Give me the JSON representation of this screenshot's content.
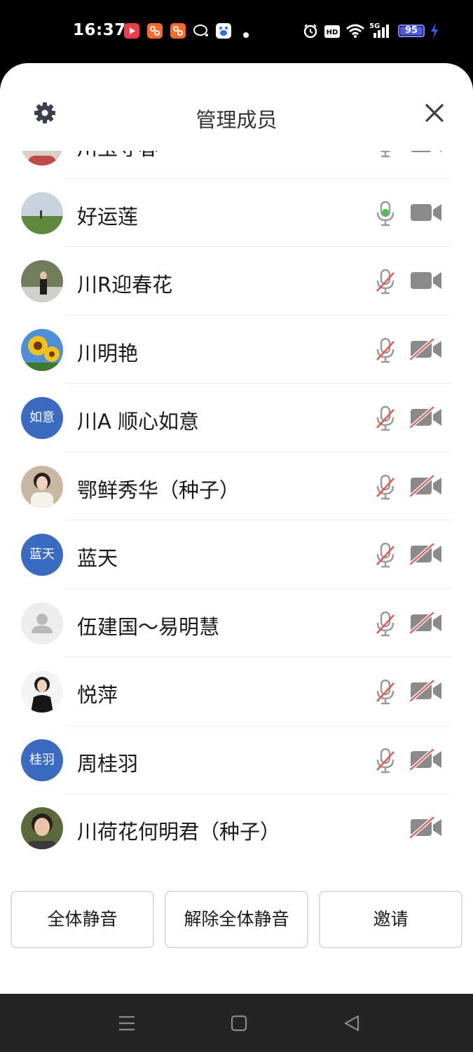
{
  "status_bar": {
    "time": "16:37",
    "battery": 95,
    "network": "5G"
  },
  "header": {
    "title": "管理成员"
  },
  "members": [
    {
      "name": "川玉守春",
      "avatar_type": "photo",
      "avatar_text": "",
      "mic": "on",
      "cam": "on"
    },
    {
      "name": "好运莲",
      "avatar_type": "photo",
      "avatar_text": "",
      "mic": "speaking",
      "cam": "on"
    },
    {
      "name": "川R迎春花",
      "avatar_type": "photo",
      "avatar_text": "",
      "mic": "off",
      "cam": "on"
    },
    {
      "name": "川明艳",
      "avatar_type": "photo",
      "avatar_text": "",
      "mic": "off",
      "cam": "off"
    },
    {
      "name": "川A 顺心如意",
      "avatar_type": "text",
      "avatar_text": "如意",
      "mic": "off",
      "cam": "off"
    },
    {
      "name": "鄂鲜秀华（种子）",
      "avatar_type": "photo",
      "avatar_text": "",
      "mic": "off",
      "cam": "off"
    },
    {
      "name": "蓝天",
      "avatar_type": "text",
      "avatar_text": "蓝天",
      "mic": "off",
      "cam": "off"
    },
    {
      "name": "伍建国～易明慧",
      "avatar_type": "default",
      "avatar_text": "",
      "mic": "off",
      "cam": "off"
    },
    {
      "name": "悦萍",
      "avatar_type": "photo",
      "avatar_text": "",
      "mic": "off",
      "cam": "off"
    },
    {
      "name": "周桂羽",
      "avatar_type": "text",
      "avatar_text": "桂羽",
      "mic": "off",
      "cam": "off"
    },
    {
      "name": "川荷花何明君（种子）",
      "avatar_type": "photo",
      "avatar_text": "",
      "mic": "none",
      "cam": "off"
    }
  ],
  "actions": {
    "mute_all": "全体静音",
    "unmute_all": "解除全体静音",
    "invite": "邀请"
  },
  "colors": {
    "accent_blue": "#3b6bc0",
    "mic_green": "#4cc24c",
    "off_red": "#e05a4f",
    "icon_gray": "#9a9a9a"
  }
}
